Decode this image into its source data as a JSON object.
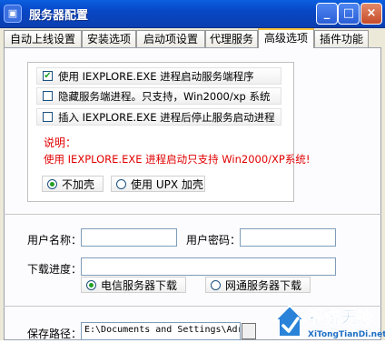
{
  "window": {
    "title": "服务器配置",
    "sys_icon": "▣",
    "buttons": {
      "minimize": "_",
      "maximize": "□",
      "close": "×"
    }
  },
  "tabs": [
    {
      "label": "自动上线设置"
    },
    {
      "label": "安装选项"
    },
    {
      "label": "启动项设置"
    },
    {
      "label": "代理服务"
    },
    {
      "label": "高级选项",
      "active": true
    },
    {
      "label": "插件功能"
    }
  ],
  "advanced": {
    "options": [
      {
        "label": "使用 IEXPLORE.EXE 进程启动服务端程序",
        "checked": true
      },
      {
        "label": "隐藏服务端进程。只支持，Win2000/xp 系统",
        "checked": false
      },
      {
        "label": "插入 IEXPLORE.EXE 进程后停止服务启动进程",
        "checked": false
      }
    ],
    "note_title": "说明：",
    "note_text": "使用 IEXPLORE.EXE 进程启动只支持 Win2000/XP系统!",
    "shell_options": [
      {
        "label": "不加壳",
        "selected": true
      },
      {
        "label": "使用 UPX 加壳",
        "selected": false
      }
    ]
  },
  "download": {
    "username_label": "用户名称：",
    "username_value": "",
    "password_label": "用户密码：",
    "password_value": "",
    "progress_label": "下载进度：",
    "progress_value": "",
    "server_options": [
      {
        "label": "电信服务器下载",
        "selected": true
      },
      {
        "label": "网通服务器下载",
        "selected": false
      }
    ]
  },
  "save": {
    "path_label": "保存路径：",
    "path_value": "E:\\Documents and Settings\\Adr"
  },
  "watermark": {
    "name": "系统天地",
    "url": "XiTongTianDi.net"
  },
  "colors": {
    "titlebar": "#0a5fe0",
    "note": "#e00000",
    "accent_tab": "#ffc83c"
  }
}
